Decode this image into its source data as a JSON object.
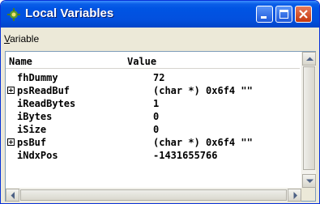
{
  "window": {
    "title": "Local Variables",
    "icon": "app-icon"
  },
  "menu": {
    "items": [
      {
        "underline": "V",
        "rest": "ariable"
      }
    ]
  },
  "table": {
    "columns": {
      "name": "Name",
      "value": "Value"
    },
    "rows": [
      {
        "name": "fhDummy",
        "value": "72",
        "expandable": false
      },
      {
        "name": "psReadBuf",
        "value": "(char *) 0x6f4 \"\"",
        "expandable": true
      },
      {
        "name": "iReadBytes",
        "value": "1",
        "expandable": false
      },
      {
        "name": "iBytes",
        "value": "0",
        "expandable": false
      },
      {
        "name": "iSize",
        "value": "0",
        "expandable": false
      },
      {
        "name": "psBuf",
        "value": "(char *) 0x6f4 \"\"",
        "expandable": true
      },
      {
        "name": "iNdxPos",
        "value": "-1431655766",
        "expandable": false
      }
    ]
  }
}
